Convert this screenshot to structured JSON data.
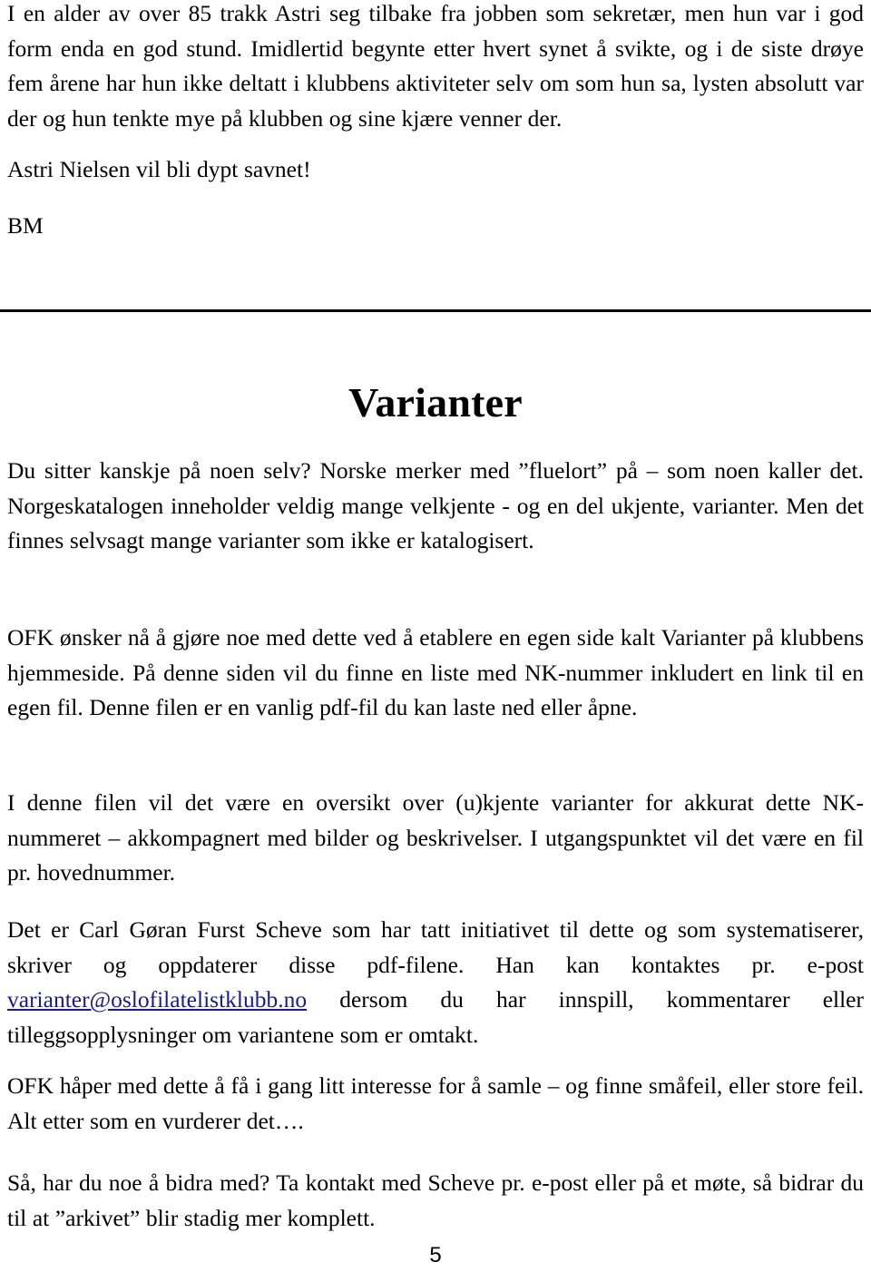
{
  "document": {
    "page_number": "5",
    "link_color": "#1a1a8c",
    "text_color": "#000000",
    "background_color": "#ffffff"
  },
  "obituary": {
    "body": "I en alder av over 85 trakk Astri seg tilbake fra jobben som sekretær, men hun var i god form enda en god stund. Imidlertid begynte etter hvert synet å svikte, og i de siste drøye fem årene har hun ikke deltatt i klubbens aktiviteter selv om som hun sa, lysten absolutt var der og hun tenkte mye på klubben og sine kjære venner der.",
    "closing": "Astri Nielsen vil bli dypt savnet!",
    "signature": "BM"
  },
  "article": {
    "title": "Varianter",
    "paragraph_1": "Du sitter kanskje på noen selv? Norske merker med ”fluelort” på – som noen kaller det. Norgeskatalogen inneholder veldig mange velkjente - og en del ukjente, varianter. Men det finnes selvsagt mange varianter som ikke er katalogisert.",
    "paragraph_2": "OFK ønsker nå å gjøre noe med dette ved å etablere en egen side kalt Varianter på klubbens hjemmeside. På denne siden vil du finne en liste med NK-nummer inkludert en link til en egen fil. Denne filen er en vanlig pdf-fil du kan laste ned eller åpne.",
    "paragraph_3": "I denne filen vil det være en oversikt over (u)kjente varianter for akkurat dette NK-nummeret – akkompagnert med bilder og beskrivelser. I utgangspunktet vil det være en fil pr. hovednummer.",
    "paragraph_4_before_link": "Det er Carl Gøran Furst Scheve som har tatt initiativet til dette og som systematiserer, skriver og oppdaterer disse pdf-filene. Han kan kontaktes pr. e-post ",
    "email_link": "varianter@oslofilatelistklubb.no",
    "paragraph_4_after_link": " dersom du har innspill, kommentarer eller tilleggsopplysninger om variantene som er omtakt.",
    "paragraph_5": "OFK håper med dette å få i gang litt interesse for å samle – og finne småfeil, eller store feil. Alt etter som en vurderer det….",
    "paragraph_6": "Så, har du noe å bidra med? Ta kontakt med Scheve pr. e-post eller på et møte, så bidrar du til at ”arkivet” blir stadig mer komplett."
  }
}
